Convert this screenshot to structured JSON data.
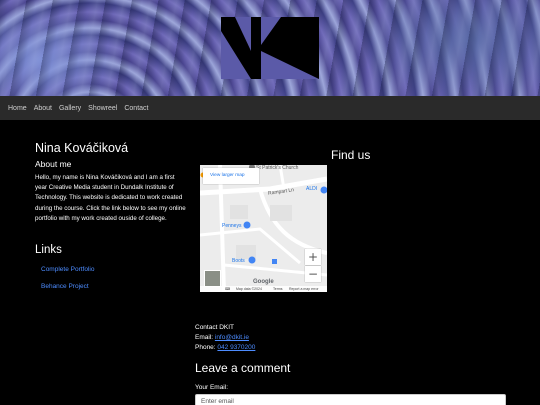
{
  "nav": {
    "items": [
      "Home",
      "About",
      "Gallery",
      "Showreel",
      "Contact"
    ]
  },
  "profile": {
    "name": "Nina Kováčiková",
    "about_heading": "About me",
    "about_text": "Hello, my name is Nina Kováčiková and I am a first year Creative Media student in Dundalk Institute of Technology. This website is dedicated to work created during the course. Click the link below to see my online portfolio with my work created ouside of college."
  },
  "links": {
    "heading": "Links",
    "items": [
      "Complete Portfolio",
      "Behance Project"
    ]
  },
  "find_us": {
    "heading": "Find us",
    "map": {
      "larger_map_label": "View larger map",
      "labels": [
        "St Patrick's Church",
        "Rampart Ln",
        "ALDI",
        "Penneys",
        "Boots"
      ],
      "zoom_in": "+",
      "zoom_out": "−",
      "google": "Google",
      "footer": [
        "Map data ©2024",
        "Terms",
        "Report a map error"
      ]
    }
  },
  "contact": {
    "title": "Contact DKIT",
    "email_label": "Email:",
    "email": "info@dkit.ie",
    "phone_label": "Phone:",
    "phone": "042 9370200"
  },
  "comment": {
    "heading": "Leave a comment",
    "email_label": "Your Email:",
    "email_placeholder": "Enter email"
  },
  "colors": {
    "background": "#000000",
    "navbar": "#2a2a2a",
    "link": "#4d8cff",
    "banner": "#5b5aa8"
  }
}
